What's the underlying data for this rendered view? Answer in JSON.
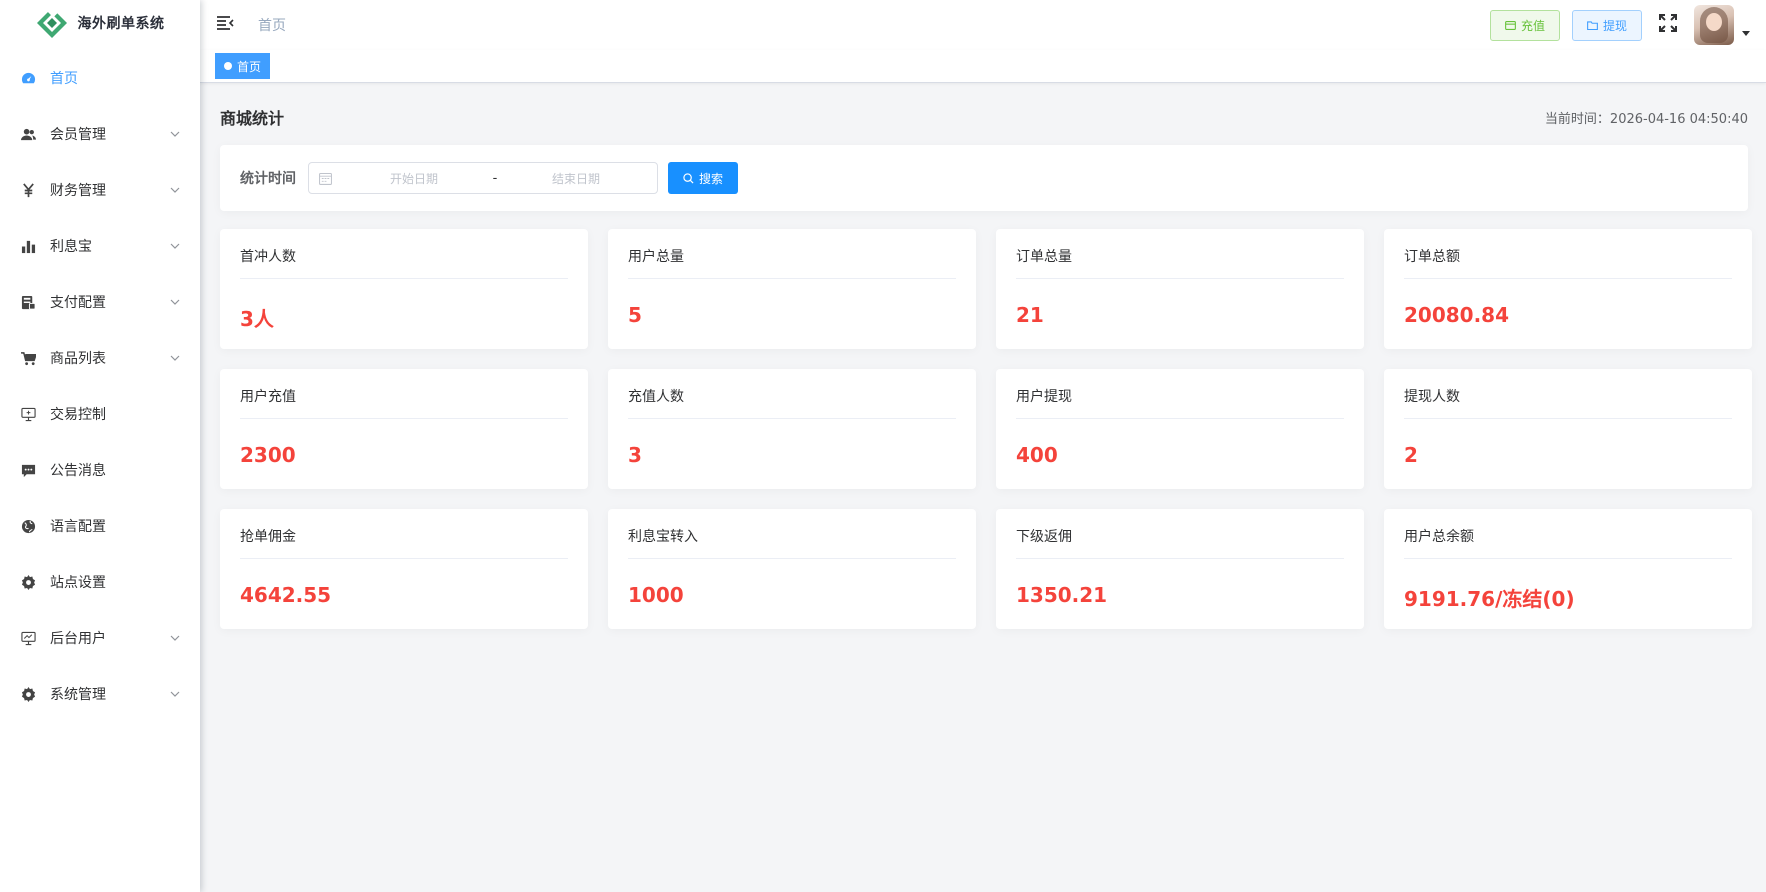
{
  "app": {
    "title": "海外刷单系统"
  },
  "sidebar": {
    "items": [
      {
        "label": "首页",
        "icon": "dashboard-icon",
        "active": true,
        "expandable": false
      },
      {
        "label": "会员管理",
        "icon": "user-icon",
        "active": false,
        "expandable": true
      },
      {
        "label": "财务管理",
        "icon": "yen-icon",
        "active": false,
        "expandable": true
      },
      {
        "label": "利息宝",
        "icon": "bar-chart-icon",
        "active": false,
        "expandable": true
      },
      {
        "label": "支付配置",
        "icon": "payment-icon",
        "active": false,
        "expandable": true
      },
      {
        "label": "商品列表",
        "icon": "cart-icon",
        "active": false,
        "expandable": true
      },
      {
        "label": "交易控制",
        "icon": "monitor-icon",
        "active": false,
        "expandable": false
      },
      {
        "label": "公告消息",
        "icon": "message-icon",
        "active": false,
        "expandable": false
      },
      {
        "label": "语言配置",
        "icon": "globe-icon",
        "active": false,
        "expandable": false
      },
      {
        "label": "站点设置",
        "icon": "gear-icon",
        "active": false,
        "expandable": false
      },
      {
        "label": "后台用户",
        "icon": "monitor-chart-icon",
        "active": false,
        "expandable": true
      },
      {
        "label": "系统管理",
        "icon": "gear-icon",
        "active": false,
        "expandable": true
      }
    ]
  },
  "navbar": {
    "breadcrumb": "首页",
    "recharge_label": "充值",
    "withdraw_label": "提现"
  },
  "tags": [
    {
      "label": "首页",
      "active": true
    }
  ],
  "main": {
    "title": "商城统计",
    "current_time_label": "当前时间：",
    "current_time": "2026-04-16 04:50:40",
    "filter": {
      "label": "统计时间",
      "start_placeholder": "开始日期",
      "separator": "-",
      "end_placeholder": "结束日期",
      "search_label": "搜索"
    },
    "stats": [
      {
        "title": "首冲人数",
        "value": "3人"
      },
      {
        "title": "用户总量",
        "value": "5"
      },
      {
        "title": "订单总量",
        "value": "21"
      },
      {
        "title": "订单总额",
        "value": "20080.84"
      },
      {
        "title": "用户充值",
        "value": "2300"
      },
      {
        "title": "充值人数",
        "value": "3"
      },
      {
        "title": "用户提现",
        "value": "400"
      },
      {
        "title": "提现人数",
        "value": "2"
      },
      {
        "title": "抢单佣金",
        "value": "4642.55"
      },
      {
        "title": "利息宝转入",
        "value": "1000"
      },
      {
        "title": "下级返佣",
        "value": "1350.21"
      },
      {
        "title": "用户总余额",
        "value": "9191.76/冻结(0)"
      }
    ]
  },
  "colors": {
    "primary": "#409eff",
    "search_button": "#1890ff",
    "stat_value": "#f4433b",
    "recharge": "#67c23a",
    "logo_green": "#3fa872"
  }
}
